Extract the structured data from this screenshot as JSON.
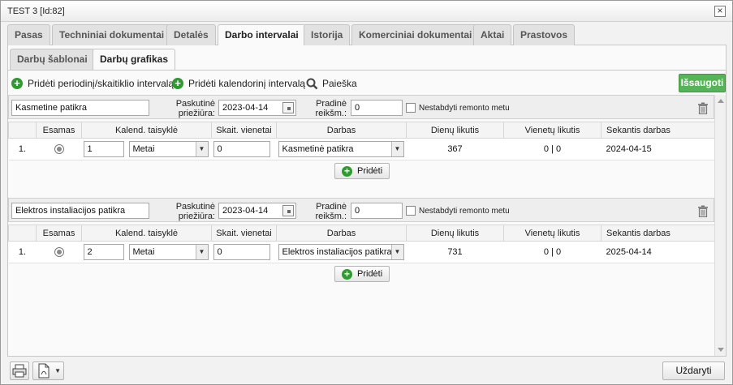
{
  "window": {
    "title": "TEST 3 [Id:82]"
  },
  "tabs": [
    {
      "label": "Pasas",
      "active": false
    },
    {
      "label": "Techniniai dokumentai",
      "active": false
    },
    {
      "label": "Detalės",
      "active": false
    },
    {
      "label": "Darbo intervalai",
      "active": true
    },
    {
      "label": "Istorija",
      "active": false
    },
    {
      "label": "Komerciniai dokumentai",
      "active": false
    },
    {
      "label": "Aktai",
      "active": false
    },
    {
      "label": "Prastovos",
      "active": false
    }
  ],
  "subtabs": [
    {
      "label": "Darbų šablonai",
      "active": false
    },
    {
      "label": "Darbų grafikas",
      "active": true
    }
  ],
  "toolbar": {
    "add_periodic": "Pridėti periodinį/skaitiklio intervalą",
    "add_calendar": "Pridėti kalendorinį intervalą",
    "search": "Paieška",
    "save": "Išsaugoti"
  },
  "labels": {
    "last_maintenance_1": "Paskutinė",
    "last_maintenance_2": "priežiūra:",
    "initial_value_1": "Pradinė",
    "initial_value_2": "reikšm.:",
    "no_stop": "Nestabdyti remonto metu",
    "add_row": "Pridėti"
  },
  "columns": [
    "Esamas",
    "Kalend. taisyklė",
    "Skait. vienetai",
    "Darbas",
    "Dienų likutis",
    "Vienetų likutis",
    "Sekantis darbas"
  ],
  "groups": [
    {
      "name": "Kasmetine patikra",
      "last_date": "2023-04-14",
      "initial_value": "0",
      "row": {
        "index": "1.",
        "rule_count": "1",
        "rule_period": "Metai",
        "units": "0",
        "work": "Kasmetinė patikra",
        "days_left": "367",
        "units_left": "0 | 0",
        "next_work": "2024-04-15"
      }
    },
    {
      "name": "Elektros instaliacijos patikra",
      "last_date": "2023-04-14",
      "initial_value": "0",
      "row": {
        "index": "1.",
        "rule_count": "2",
        "rule_period": "Metai",
        "units": "0",
        "work": "Elektros instaliacijos patikra",
        "days_left": "731",
        "units_left": "0 | 0",
        "next_work": "2025-04-14"
      }
    }
  ],
  "footer": {
    "close": "Uždaryti"
  },
  "colors": {
    "accent_green": "#56b456",
    "icon_green": "#2f9a2f"
  }
}
